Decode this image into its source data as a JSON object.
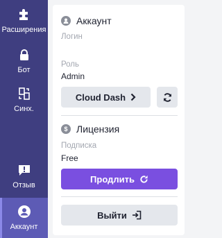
{
  "sidebar": {
    "items": [
      {
        "label": "Расширения",
        "icon": "puzzle-icon"
      },
      {
        "label": "Бот",
        "icon": "lock-icon"
      },
      {
        "label": "Синх.",
        "icon": "sync-files-icon"
      },
      {
        "label": "Отзыв",
        "icon": "feedback-icon"
      },
      {
        "label": "Аккаунт",
        "icon": "user-icon",
        "active": true
      }
    ]
  },
  "account": {
    "title": "Аккаунт",
    "login_label": "Логин",
    "login_value": "",
    "role_label": "Роль",
    "role_value": "Admin",
    "dashboard_button": "Cloud Dash"
  },
  "license": {
    "title": "Лицензия",
    "subscription_label": "Подписка",
    "subscription_value": "Free",
    "renew_button": "Продлить"
  },
  "logout_button": "Выйти",
  "colors": {
    "sidebar_bg": "#3f3e80",
    "sidebar_active": "#5d5bb5",
    "accent_purple": "#7a4fe0",
    "button_gray": "#e4e7ec"
  }
}
